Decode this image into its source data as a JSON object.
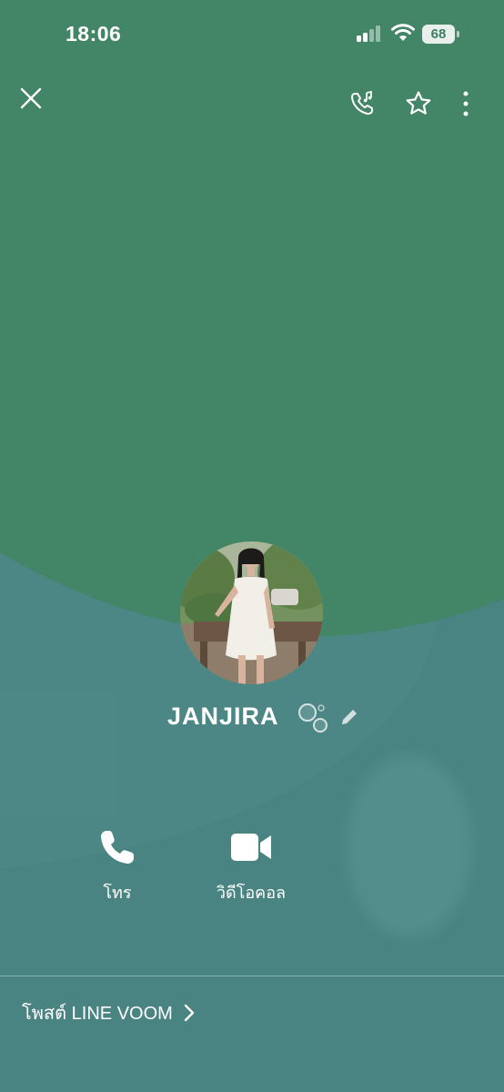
{
  "statusbar": {
    "time": "18:06",
    "battery": "68"
  },
  "profile": {
    "name": "JANJIRA"
  },
  "actions": [
    {
      "label": "โทร",
      "icon": "phone-icon"
    },
    {
      "label": "วิดีโอคอล",
      "icon": "video-camera-icon"
    }
  ],
  "footer": {
    "voom_label": "โพสต์ LINE VOOM"
  },
  "colors": {
    "top_green": "#438567",
    "teal_bg": "#4a8482",
    "text": "#ffffff"
  }
}
